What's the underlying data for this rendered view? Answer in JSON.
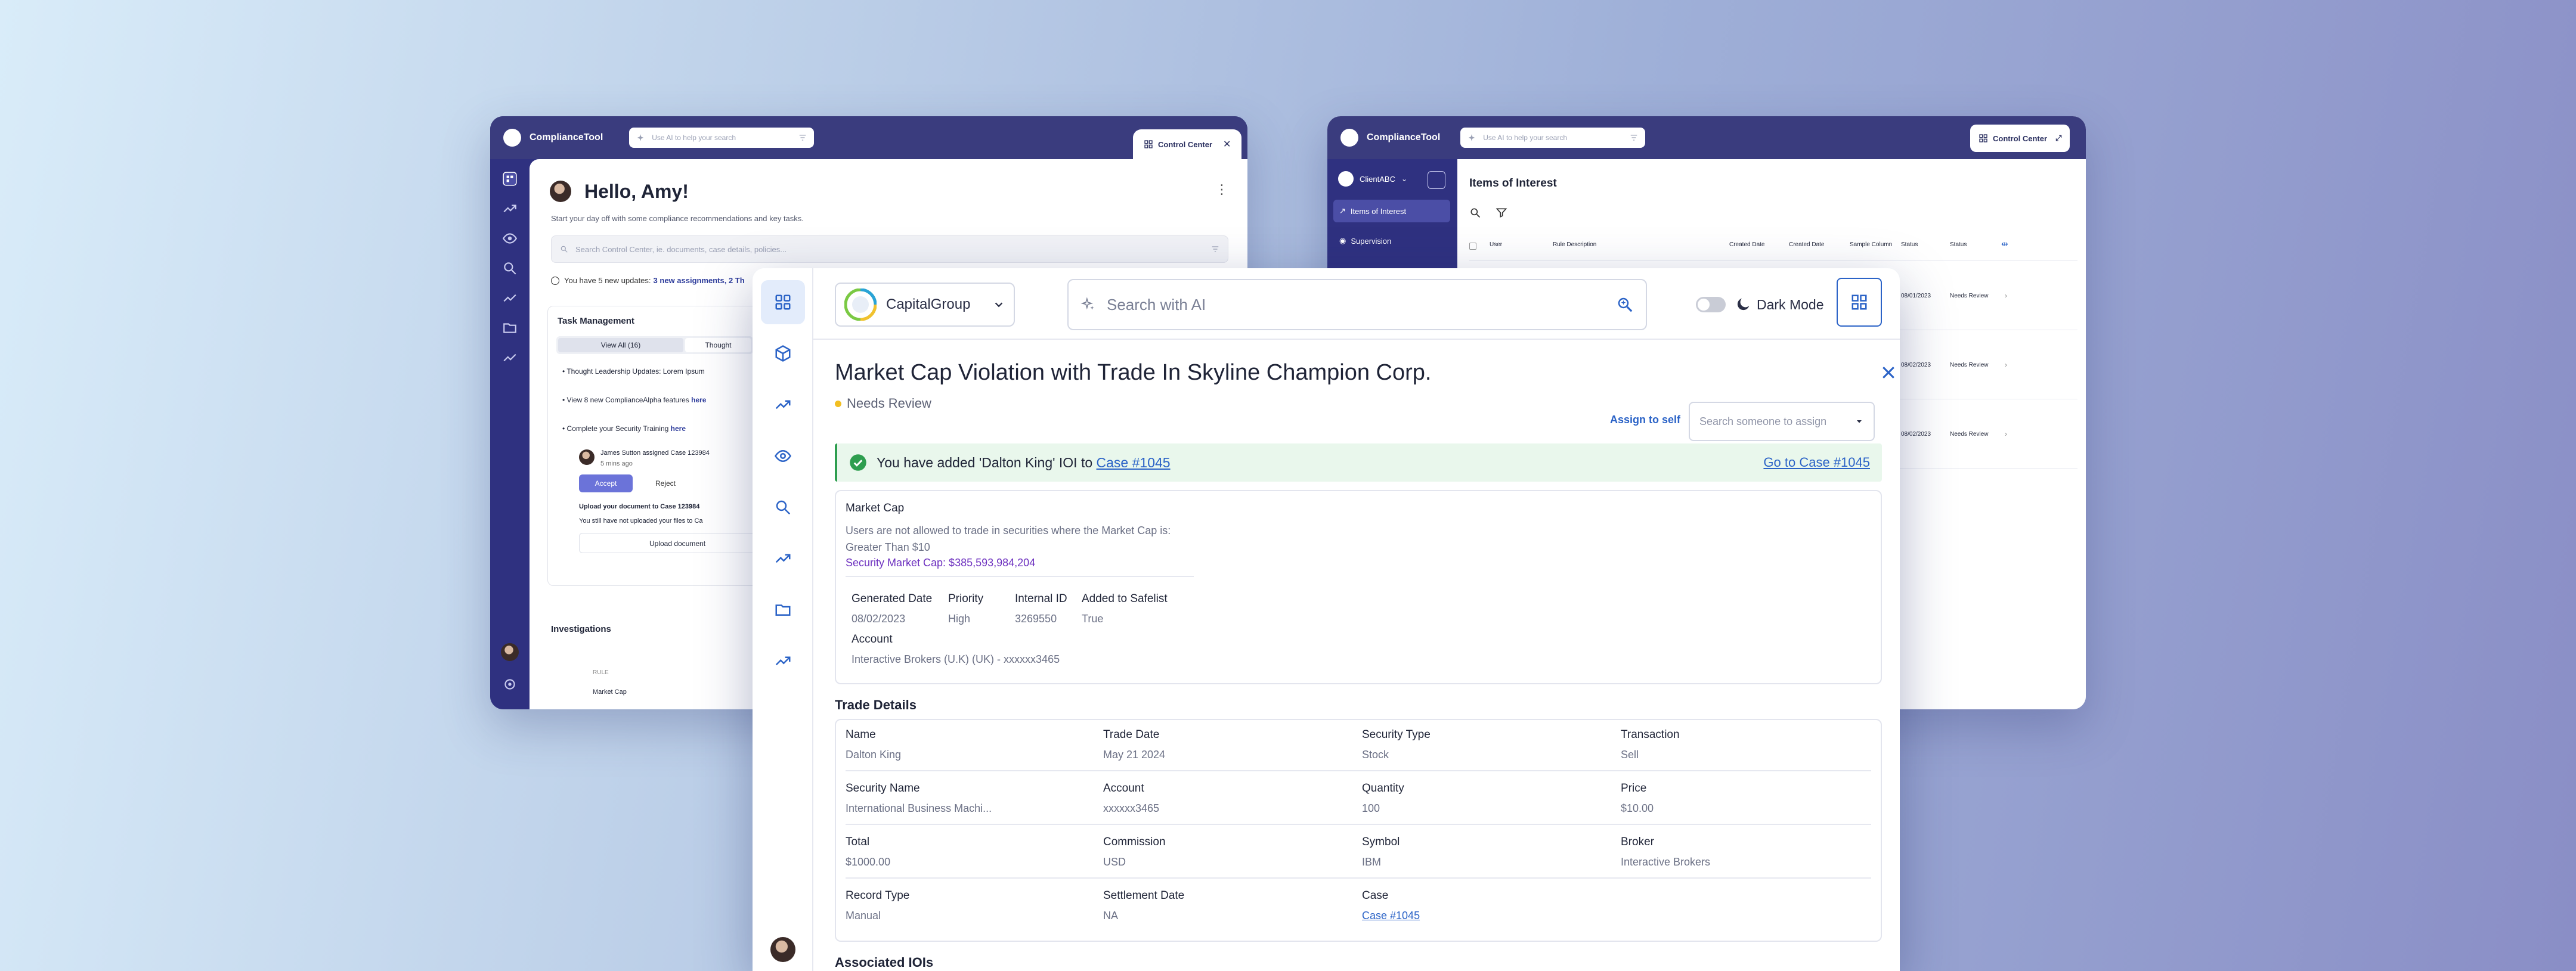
{
  "left_window": {
    "app_name": "ComplianceTool",
    "search_placeholder": "Use AI to help your search",
    "control_center_tab": "Control Center",
    "greeting": "Hello, Amy!",
    "subtitle": "Start your day off with some compliance recommendations and key tasks.",
    "search_cc_placeholder": "Search Control Center, ie. documents, case details, policies...",
    "updates_prefix": "You have 5 new updates:",
    "updates_link": "3 new assignments, 2 Th",
    "task_management_title": "Task Management",
    "task_tabs": [
      "View All (16)",
      "Thought"
    ],
    "tasks": [
      {
        "prefix": "Thought Leadership Updates: Lorem Ipsum",
        "link": ""
      },
      {
        "prefix": "View 8 new ComplianceAlpha features",
        "link": "here"
      },
      {
        "prefix": "Complete your Security Training",
        "link": "here"
      }
    ],
    "assignment_text": "James Sutton assigned Case 123984",
    "assignment_time": "5 mins ago",
    "accept_label": "Accept",
    "reject_label": "Reject",
    "upload_title": "Upload your document to Case 123984",
    "upload_desc": "You still have not uploaded your files to Ca",
    "upload_button": "Upload document",
    "investigations_title": "Investigations",
    "inv_col_rule": "RULE",
    "inv_row_rule": "Market Cap"
  },
  "right_window": {
    "app_name": "ComplianceTool",
    "search_placeholder": "Use AI to help your search",
    "control_center_tab": "Control Center",
    "client_name": "ClientABC",
    "nav_items": [
      "Items of Interest",
      "Supervision"
    ],
    "page_title": "Items of Interest",
    "columns": [
      "User",
      "Rule Description",
      "Created Date",
      "Created Date",
      "Sample Column",
      "Status",
      "Status"
    ],
    "rows": [
      {
        "date": "08/01/2023",
        "status": "Needs Review"
      },
      {
        "date": "08/02/2023",
        "status": "Needs Review"
      },
      {
        "date": "08/02/2023",
        "status": "Needs Review"
      }
    ]
  },
  "main_window": {
    "org_name": "CapitalGroup",
    "ai_search_placeholder": "Search with AI",
    "dark_mode_label": "Dark Mode",
    "case_title": "Market Cap Violation with Trade In Skyline Champion Corp.",
    "status": "Needs Review",
    "assign_self_label": "Assign to self",
    "assign_placeholder": "Search someone to assign",
    "success_message": "You have added 'Dalton King' IOI to",
    "success_case_link": "Case #1045",
    "go_to_case_label": "Go to Case #1045",
    "rule": {
      "title": "Market Cap",
      "description": "Users are not allowed to trade in securities where the Market Cap is: Greater Than $10",
      "security_market_cap": "Security Market Cap: $385,593,984,204"
    },
    "rule_fields": [
      {
        "label": "Generated Date",
        "value": "08/02/2023"
      },
      {
        "label": "Priority",
        "value": "High"
      },
      {
        "label": "Internal ID",
        "value": "3269550"
      },
      {
        "label": "Added to Safelist",
        "value": "True"
      }
    ],
    "account_label": "Account",
    "account_value": "Interactive Brokers (U.K) (UK) - xxxxxx3465",
    "trade_details_title": "Trade Details",
    "trade_rows": [
      [
        {
          "label": "Name",
          "value": "Dalton King"
        },
        {
          "label": "Trade Date",
          "value": "May 21 2024"
        },
        {
          "label": "Security Type",
          "value": "Stock"
        },
        {
          "label": "Transaction",
          "value": "Sell"
        }
      ],
      [
        {
          "label": "Security Name",
          "value": "International Business Machi..."
        },
        {
          "label": "Account",
          "value": "xxxxxx3465"
        },
        {
          "label": "Quantity",
          "value": "100"
        },
        {
          "label": "Price",
          "value": "$10.00"
        }
      ],
      [
        {
          "label": "Total",
          "value": "$1000.00"
        },
        {
          "label": "Commission",
          "value": "USD"
        },
        {
          "label": "Symbol",
          "value": "IBM"
        },
        {
          "label": "Broker",
          "value": "Interactive Brokers"
        }
      ],
      [
        {
          "label": "Record Type",
          "value": "Manual"
        },
        {
          "label": "Settlement Date",
          "value": "NA"
        },
        {
          "label": "Case",
          "value": "Case #1045"
        },
        {
          "label": "",
          "value": ""
        }
      ]
    ],
    "associated_title": "Associated IOIs"
  },
  "colors": {
    "nav_dark": "#3a3c7e",
    "accent_blue": "#2b63c7",
    "success_green": "#2e9e4f",
    "status_yellow": "#f2bf22",
    "purple": "#6c2fbf"
  },
  "icons": {
    "rail": [
      "dashboard-icon",
      "cube-icon",
      "trend-icon",
      "eye-icon",
      "search-icon",
      "trend-icon",
      "folder-icon",
      "trend-icon"
    ]
  }
}
